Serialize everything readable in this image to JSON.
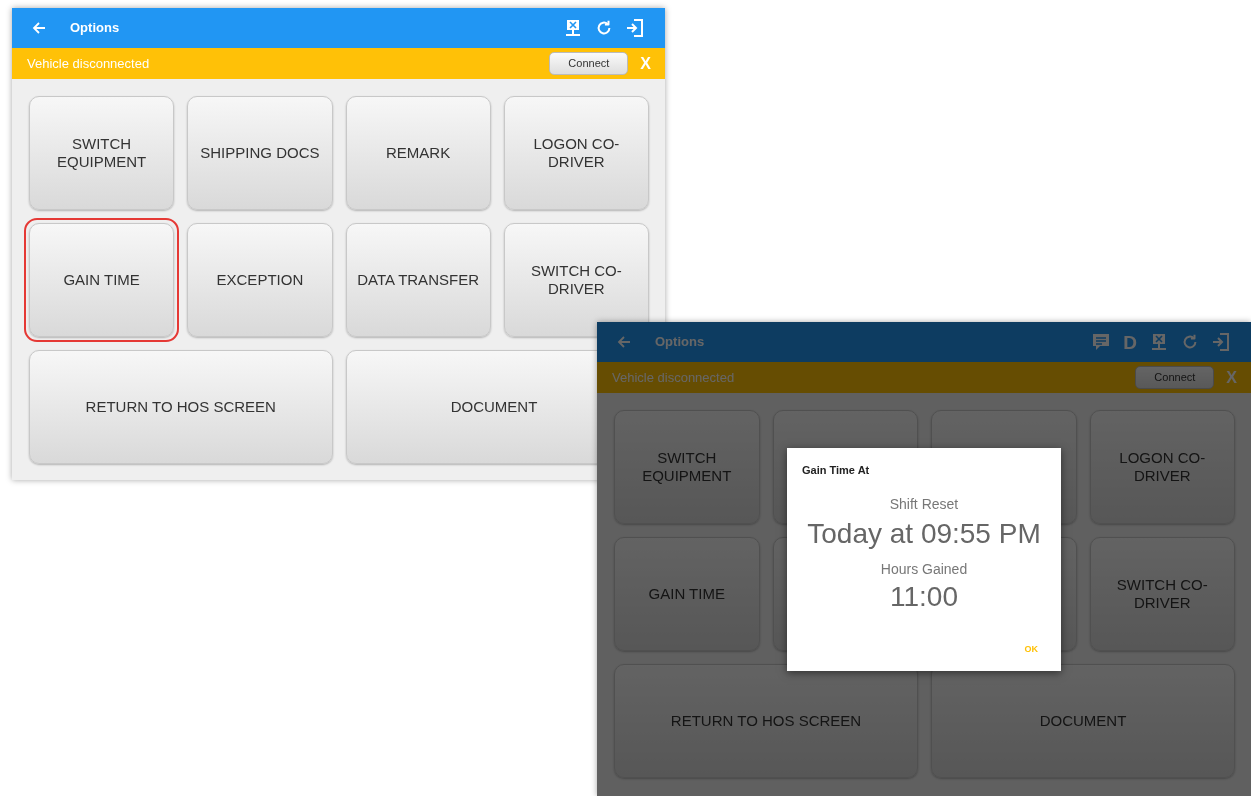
{
  "screens": [
    {
      "title": "Options",
      "toolbar_icons": [
        {
          "kind": "network"
        },
        {
          "kind": "refresh"
        },
        {
          "kind": "logout"
        }
      ],
      "banner": {
        "text": "Vehicle disconnected",
        "button": "Connect",
        "close": "X"
      },
      "buttons": [
        {
          "label": "SWITCH EQUIPMENT",
          "wide": false,
          "highlighted": false
        },
        {
          "label": "SHIPPING DOCS",
          "wide": false,
          "highlighted": false
        },
        {
          "label": "REMARK",
          "wide": false,
          "highlighted": false
        },
        {
          "label": "LOGON CO-DRIVER",
          "wide": false,
          "highlighted": false
        },
        {
          "label": "GAIN TIME",
          "wide": false,
          "highlighted": true
        },
        {
          "label": "EXCEPTION",
          "wide": false,
          "highlighted": false
        },
        {
          "label": "DATA TRANSFER",
          "wide": false,
          "highlighted": false
        },
        {
          "label": "SWITCH CO-DRIVER",
          "wide": false,
          "highlighted": false
        },
        {
          "label": "RETURN TO HOS SCREEN",
          "wide": true,
          "highlighted": false
        },
        {
          "label": "DOCUMENT",
          "wide": true,
          "highlighted": false
        }
      ]
    },
    {
      "title": "Options",
      "toolbar_icons": [
        {
          "kind": "message"
        },
        {
          "kind": "text",
          "label": "D"
        },
        {
          "kind": "network"
        },
        {
          "kind": "refresh"
        },
        {
          "kind": "logout"
        }
      ],
      "banner": {
        "text": "Vehicle disconnected",
        "button": "Connect",
        "close": "X"
      },
      "buttons": [
        {
          "label": "SWITCH EQUIPMENT",
          "wide": false,
          "highlighted": false
        },
        {
          "wide": false,
          "highlighted": false
        },
        {
          "wide": false,
          "highlighted": false
        },
        {
          "label": "LOGON CO-DRIVER",
          "wide": false,
          "highlighted": false
        },
        {
          "label": "GAIN TIME",
          "wide": false,
          "highlighted": false
        },
        {
          "wide": false,
          "highlighted": false
        },
        {
          "wide": false,
          "highlighted": false
        },
        {
          "label": "SWITCH CO-DRIVER",
          "wide": false,
          "highlighted": false
        },
        {
          "label": "RETURN TO HOS SCREEN",
          "wide": true,
          "highlighted": false
        },
        {
          "label": "DOCUMENT",
          "wide": true,
          "highlighted": false
        }
      ],
      "dialog": {
        "title": "Gain Time At",
        "label_1": "Shift Reset",
        "value_1": "Today at 09:55 PM",
        "label_2": "Hours Gained",
        "value_2": "11:00",
        "button": "OK"
      }
    }
  ]
}
